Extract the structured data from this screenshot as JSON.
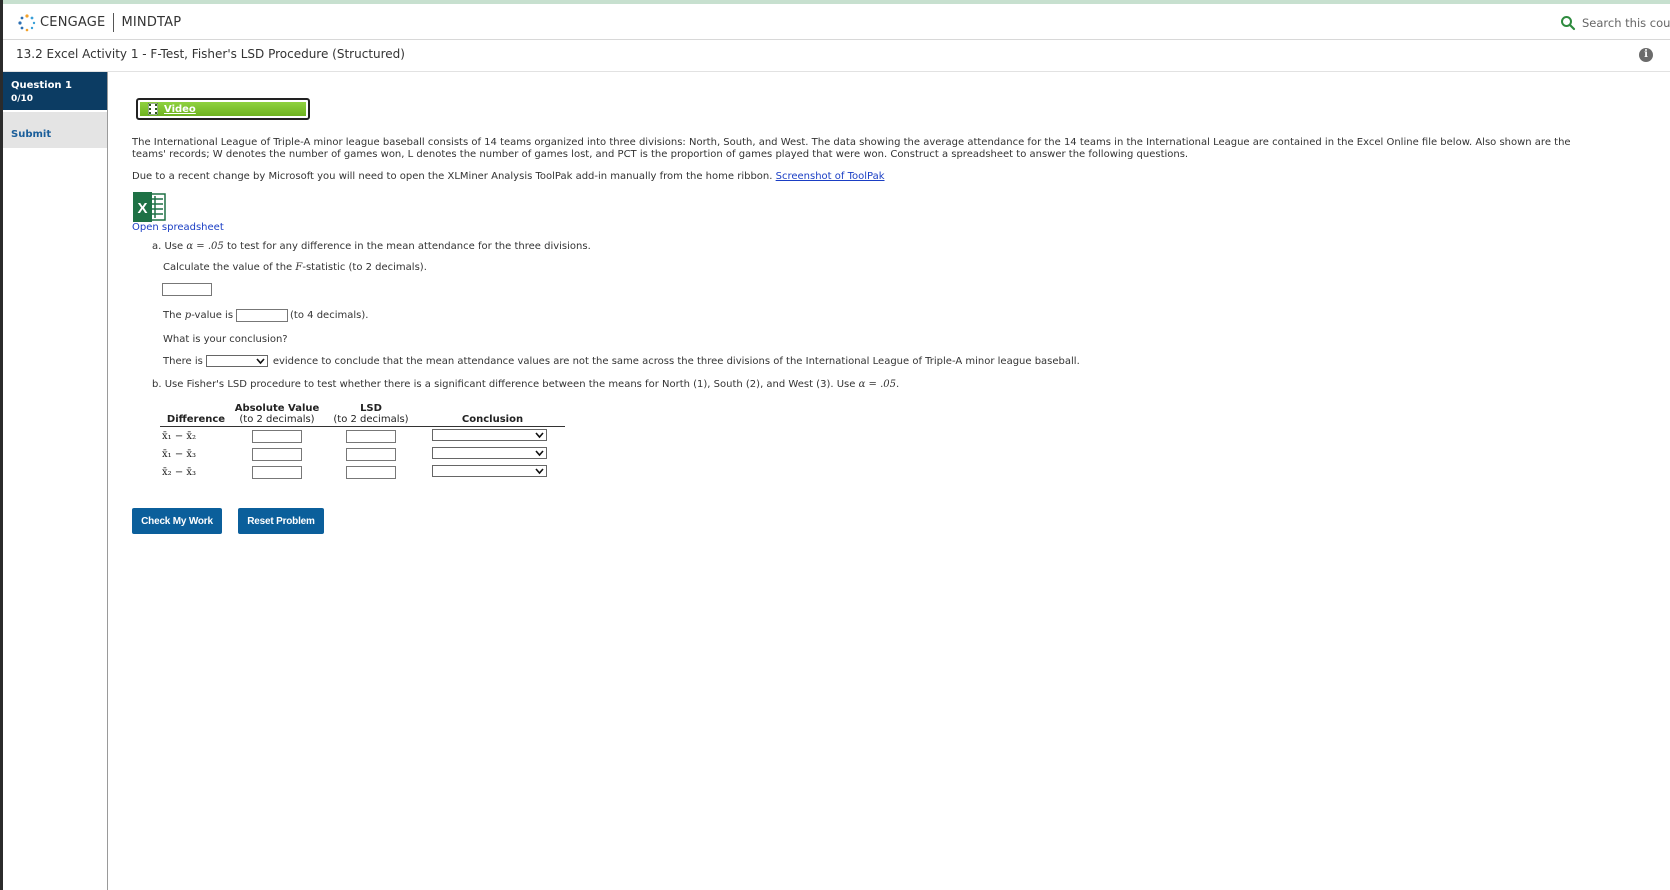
{
  "header": {
    "brand_name": "CENGAGE",
    "product_name": "MINDTAP",
    "search_placeholder": "Search this cours"
  },
  "titlebar": {
    "title": "13.2 Excel Activity 1 - F-Test, Fisher's LSD Procedure (Structured)"
  },
  "sidebar": {
    "question_label": "Question 1",
    "question_score": "0/10",
    "submit_label": "Submit"
  },
  "content": {
    "video_label": "Video",
    "intro": "The International League of Triple-A minor league baseball consists of 14 teams organized into three divisions: North, South, and West. The data showing the average attendance for the 14 teams in the International League are contained in the Excel Online file below. Also shown are the teams' records; W denotes the number of games won, L denotes the number of games lost, and PCT is the proportion of games played that were won. Construct a spreadsheet to answer the following questions.",
    "toolpak_text": "Due to a recent change by Microsoft you will need to open the XLMiner Analysis ToolPak add-in manually from the home ribbon.",
    "toolpak_link": "Screenshot of ToolPak",
    "open_spreadsheet": "Open spreadsheet",
    "part_a": {
      "prefix": "a. Use",
      "alpha_expr": "α = .05",
      "suffix": "to test for any difference in the mean attendance for the three divisions.",
      "calc_prefix": "Calculate the value of the",
      "calc_var": "F",
      "calc_suffix": "-statistic (to 2 decimals).",
      "pvalue_prefix": "The",
      "pvalue_var": "p",
      "pvalue_mid": "-value is",
      "pvalue_suffix": "(to 4 decimals).",
      "conclusion_question": "What is your conclusion?",
      "there_is": "There is",
      "evidence_text": "evidence to conclude that the mean attendance values are not the same across the three divisions of the International League of Triple-A minor league baseball."
    },
    "part_b": {
      "text": "b. Use Fisher's LSD procedure to test whether there is a significant difference between the means for North (1), South (2), and West (3). Use",
      "alpha_expr": "α = .05."
    },
    "table": {
      "headers": {
        "difference": "Difference",
        "abs_title": "Absolute Value",
        "abs_sub": "(to 2 decimals)",
        "lsd_title": "LSD",
        "lsd_sub": "(to 2 decimals)",
        "conclusion": "Conclusion"
      },
      "rows": [
        {
          "difference": "x̄₁ − x̄₂"
        },
        {
          "difference": "x̄₁ − x̄₃"
        },
        {
          "difference": "x̄₂ − x̄₃"
        }
      ]
    },
    "buttons": {
      "check": "Check My Work",
      "reset": "Reset Problem"
    }
  },
  "colors": {
    "nav_active": "#0c3c63",
    "button": "#0b5f9b",
    "video_green": "#7cc22c",
    "link": "#1a3ec4",
    "search_icon": "#2e8b3e"
  },
  "icons": [
    "cengage-logo-icon",
    "search-icon",
    "info-icon",
    "film-icon",
    "excel-icon",
    "chevron-down-icon"
  ]
}
